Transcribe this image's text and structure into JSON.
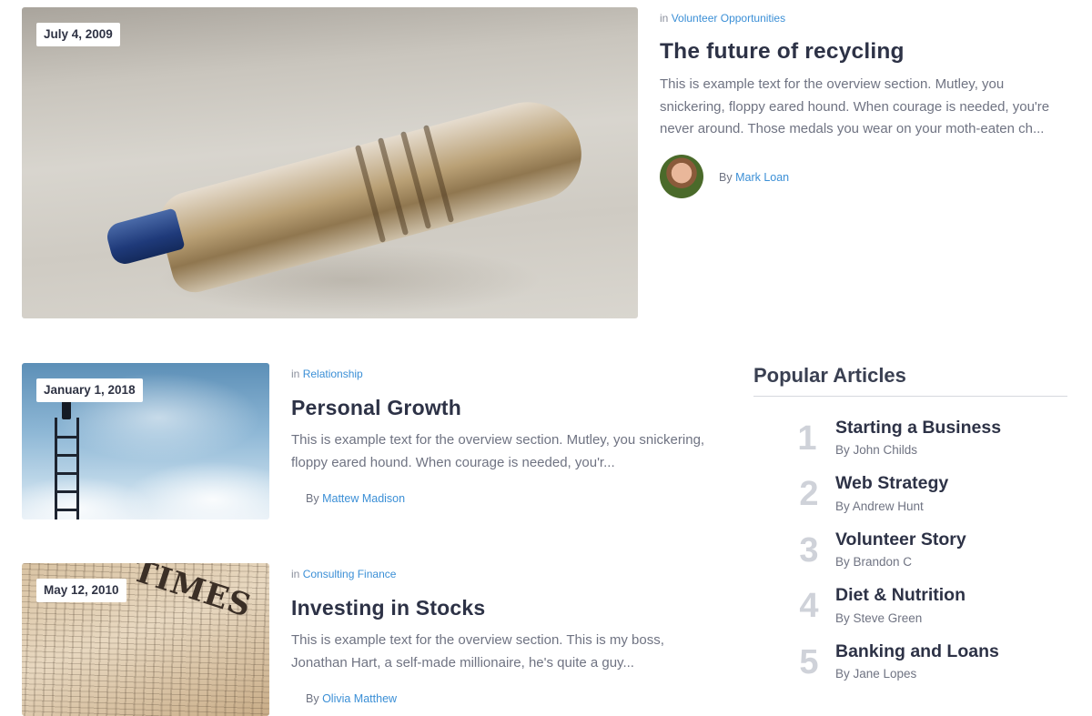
{
  "featured": {
    "date": "July 4, 2009",
    "category_prefix": "in",
    "category": "Volunteer Opportunities",
    "title": "The future of recycling",
    "excerpt": "This is example text for the overview section. Mutley, you snickering, floppy eared hound. When courage is needed, you're never around. Those medals you wear on your moth-eaten ch...",
    "byline_prefix": "By",
    "author": "Mark Loan"
  },
  "posts": [
    {
      "date": "January 1, 2018",
      "category_prefix": "in",
      "category": "Relationship",
      "title": "Personal Growth",
      "excerpt": "This is example text for the overview section. Mutley, you snickering, floppy eared hound. When courage is needed, you'r...",
      "byline_prefix": "By",
      "author": "Mattew Madison"
    },
    {
      "date": "May 12, 2010",
      "category_prefix": "in",
      "category": "Consulting Finance",
      "title": "Investing in Stocks",
      "excerpt": "This is example text for the overview section. This is my boss, Jonathan Hart, a self-made millionaire, he's quite a guy...",
      "byline_prefix": "By",
      "author": "Olivia Matthew"
    }
  ],
  "popular": {
    "heading": "Popular Articles",
    "items": [
      {
        "num": "1",
        "title": "Starting a Business",
        "author": "By John Childs"
      },
      {
        "num": "2",
        "title": "Web Strategy",
        "author": "By Andrew Hunt"
      },
      {
        "num": "3",
        "title": "Volunteer Story",
        "author": "By Brandon C"
      },
      {
        "num": "4",
        "title": "Diet & Nutrition",
        "author": "By Steve Green"
      },
      {
        "num": "5",
        "title": "Banking and Loans",
        "author": "By Jane Lopes"
      }
    ]
  },
  "colors": {
    "link": "#3b8fd6",
    "title": "#2d3246",
    "muted": "#6f7382",
    "popular_number": "#cfd2d9"
  }
}
